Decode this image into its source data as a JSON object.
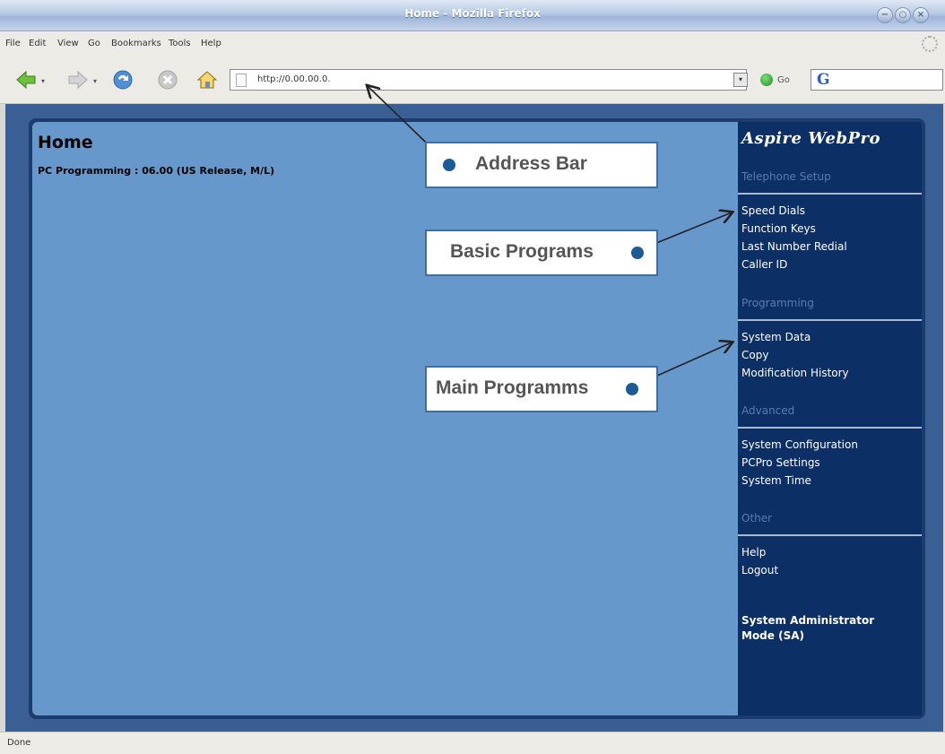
{
  "window": {
    "title": "Home - Mozilla Firefox"
  },
  "menu": [
    "File",
    "Edit",
    "View",
    "Go",
    "Bookmarks",
    "Tools",
    "Help"
  ],
  "toolbar": {
    "url": "http://0.00.00.0.",
    "go_label": "Go",
    "search_engine": "G"
  },
  "page": {
    "title": "Home",
    "version": "PC Programming : 06.00 (US Release, M/L)"
  },
  "sidebar": {
    "brand": "Aspire WebPro",
    "sections": [
      {
        "heading": "Telephone Setup",
        "links": [
          "Speed Dials",
          "Function Keys",
          "Last Number Redial",
          "Caller ID"
        ]
      },
      {
        "heading": "Programming",
        "links": [
          "System Data",
          "Copy",
          "Modification History"
        ]
      },
      {
        "heading": "Advanced",
        "links": [
          "System Configuration",
          "PCPro Settings",
          "System Time"
        ]
      },
      {
        "heading": "Other",
        "links": [
          "Help",
          "Logout"
        ]
      }
    ],
    "mode_line1": "System Administrator",
    "mode_line2": "Mode (SA)"
  },
  "callouts": {
    "address_bar": "Address Bar",
    "basic_programs": "Basic Programs",
    "main_programs": "Main Programms"
  },
  "status": {
    "text": "Done"
  }
}
